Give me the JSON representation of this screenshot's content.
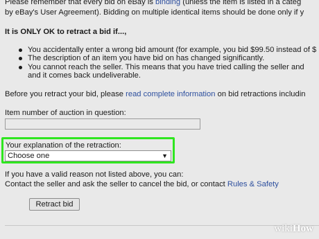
{
  "intro": {
    "line1_pre": "Please remember that every bid on eBay is ",
    "line1_link": "binding",
    "line1_post": " (unless the item is listed in a categ",
    "line2": "by eBay's User Agreement). Bidding on multiple identical items should be done only if y"
  },
  "heading": "It is ONLY OK to retract a bid if...,",
  "bullets": [
    "You accidentally enter a wrong bid amount (for example, you bid $99.50 instead of $",
    "The description of an item you have bid on has changed significantly.",
    "You cannot reach the seller. This means that you have tried calling the seller and",
    "and it comes back undeliverable."
  ],
  "before": {
    "pre": "Before you retract your bid, please ",
    "link": "read complete information",
    "post": " on bid retractions includin"
  },
  "item_field": {
    "label": "Item number of auction in question:",
    "value": ""
  },
  "explanation": {
    "label": "Your explanation of the retraction:",
    "selected": "Choose one",
    "arrow": "▼"
  },
  "help": {
    "line1": "If you have a valid reason not listed above, you can:",
    "line2_pre": "Contact the seller and ask the seller to cancel the bid, or contact ",
    "line2_link": "Rules & Safety"
  },
  "retract_button": "Retract bid",
  "watermark": {
    "wiki": "wiki",
    "how": "How"
  },
  "colors": {
    "link": "#2d4f9e",
    "highlight": "#2fe620",
    "background": "#e9e9e9"
  }
}
